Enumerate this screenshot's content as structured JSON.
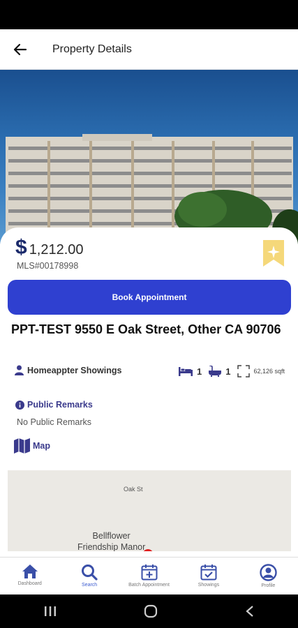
{
  "header": {
    "title": "Property Details"
  },
  "property": {
    "price_symbol": "$",
    "price": "1,212.00",
    "mls": "MLS#00178998",
    "book_label": "Book Appointment",
    "address": "PPT-TEST 9550 E Oak Street, Other CA 90706",
    "agent": "Homeappter Showings",
    "beds": "1",
    "baths": "1",
    "sqft": "62,126 sqft"
  },
  "remarks": {
    "title": "Public Remarks",
    "text": "No Public Remarks"
  },
  "map": {
    "title": "Map",
    "street": "Oak St",
    "place_line1": "Bellflower",
    "place_line2": "Friendship Manor"
  },
  "nav": {
    "items": [
      {
        "label": "Dashboard",
        "icon": "home-icon",
        "active": false
      },
      {
        "label": "Search",
        "icon": "search-icon",
        "active": true
      },
      {
        "label": "Batch Appointment",
        "icon": "calendar-plus-icon",
        "active": false
      },
      {
        "label": "Showings",
        "icon": "calendar-check-icon",
        "active": false
      },
      {
        "label": "Profile",
        "icon": "user-icon",
        "active": false
      }
    ]
  },
  "colors": {
    "accent": "#2f40d0",
    "brand_dark": "#1b2a6b",
    "bookmark": "#f5d87a",
    "nav_icon": "#3a4fa8"
  }
}
